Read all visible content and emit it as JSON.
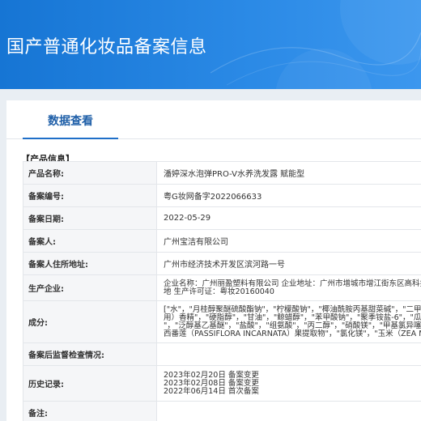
{
  "header": {
    "title": "国产普通化妆品备案信息"
  },
  "tabs": [
    {
      "label": "数据查看",
      "active": true
    }
  ],
  "section": {
    "title": "【产品信息】"
  },
  "info_rows": {
    "product_name": {
      "label": "产品名称:",
      "value": "潘婷深水泡弹PRO-V水养洗发露 赋能型"
    },
    "record_no": {
      "label": "备案编号:",
      "value": "粤G妆网备字2022066633"
    },
    "record_date": {
      "label": "备案日期:",
      "value": "2022-05-29"
    },
    "registrant": {
      "label": "备案人:",
      "value": "广州宝洁有限公司"
    },
    "address": {
      "label": "备案人住所地址:",
      "value": "广州市经济技术开发区滨河路一号"
    },
    "manufacturer": {
      "label": "生产企业:",
      "line1": "企业名称：广州丽盈塑料有限公司 企业地址：广州市增城市增江街东区高科技工",
      "line2": "地 生产许可证：粤妆20160040"
    },
    "ingredients": {
      "label": "成分:",
      "line1": "[\"水\"，\"月桂醇聚醚硫酸酯钠\"，\"柠檬酸钠\"，\"椰油酰胺丙基甜菜碱\"，\"二甲苯磺",
      "line2": "用）香精\"，\"硬脂醇\"，\"甘油\"，\"鲸蜡醇\"，\"苯甲酸钠\"，\"聚季铵盐-6\"，\"瓜儿胶",
      "line3": "\"，\"泛醇基乙基醚\"，\"盐酸\"，\"组氨酸\"，\"丙二醇\"，\"硝酸镁\"，\"甲基氯异噻唑",
      "line4": "西番莲（PASSIFLORA INCARNATA）果提取物\"，\"氯化镁\"，\"玉米（ZEA MAYS"
    },
    "supervision": {
      "label": "备案后监督检查情况:",
      "value": ""
    },
    "history": {
      "label": "历史记录:",
      "line1": "2023年02月20日 备案变更",
      "line2": "2023年02月08日 备案变更",
      "line3": "2022年06月14日 首次备案"
    },
    "remarks": {
      "label": "备注:",
      "value": ""
    }
  }
}
